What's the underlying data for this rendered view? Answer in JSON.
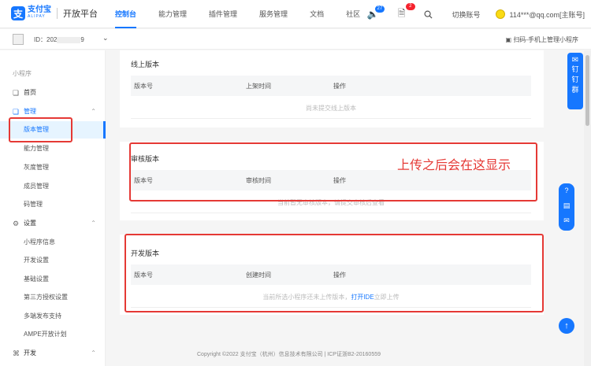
{
  "header": {
    "logo_cn": "支付宝",
    "logo_en": "ALIPAY",
    "platform": "开放平台",
    "nav": [
      {
        "label": "控制台",
        "active": true
      },
      {
        "label": "能力管理"
      },
      {
        "label": "插件管理"
      },
      {
        "label": "服务管理"
      },
      {
        "label": "文档"
      },
      {
        "label": "社区"
      }
    ],
    "notice_count": "27",
    "message_count": "2",
    "switch_account": "切换账号",
    "user": "114***@qq.com[主账号]",
    "icons": {
      "notice": "speaker-icon",
      "message": "document-icon",
      "search": "search-icon"
    }
  },
  "app": {
    "id_label": "ID：202",
    "id_tail": "9",
    "scan_link": "扫码-手机上管理小程序"
  },
  "sidebar": {
    "group_title": "小程序",
    "items": [
      {
        "label": "首页",
        "icon": "cube-icon"
      },
      {
        "label": "管理",
        "icon": "cube-icon"
      },
      {
        "label": "版本管理"
      },
      {
        "label": "能力管理"
      },
      {
        "label": "灰度管理"
      },
      {
        "label": "成员管理"
      },
      {
        "label": "码管理"
      },
      {
        "label": "设置",
        "icon": "gear-icon"
      },
      {
        "label": "小程序信息"
      },
      {
        "label": "开发设置"
      },
      {
        "label": "基础设置"
      },
      {
        "label": "第三方授权设置"
      },
      {
        "label": "多端发布支持"
      },
      {
        "label": "AMPE开放计划"
      },
      {
        "label": "开发",
        "icon": "code-icon"
      }
    ]
  },
  "online": {
    "title": "线上版本",
    "columns": [
      "版本号",
      "上架时间",
      "操作"
    ],
    "empty": "尚未提交线上版本"
  },
  "review": {
    "title": "审核版本",
    "columns": [
      "版本号",
      "审核时间",
      "操作"
    ],
    "empty": "当前暂无审核版本，请提交审核后查看"
  },
  "dev": {
    "title": "开发版本",
    "columns": [
      "版本号",
      "创建时间",
      "操作"
    ],
    "empty_prefix": "当前所选小程序还未上传版本，",
    "empty_link": "打开IDE",
    "empty_suffix": "立即上传"
  },
  "annotation": "上传之后会在这显示",
  "footer": "Copyright ©2022 支付宝（杭州）信息技术有限公司 | ICP证浙B2-20160559",
  "float": {
    "dingtalk": [
      "钉",
      "钉",
      "群"
    ]
  },
  "colors": {
    "brand": "#1677ff",
    "annotation": "#e53935"
  }
}
